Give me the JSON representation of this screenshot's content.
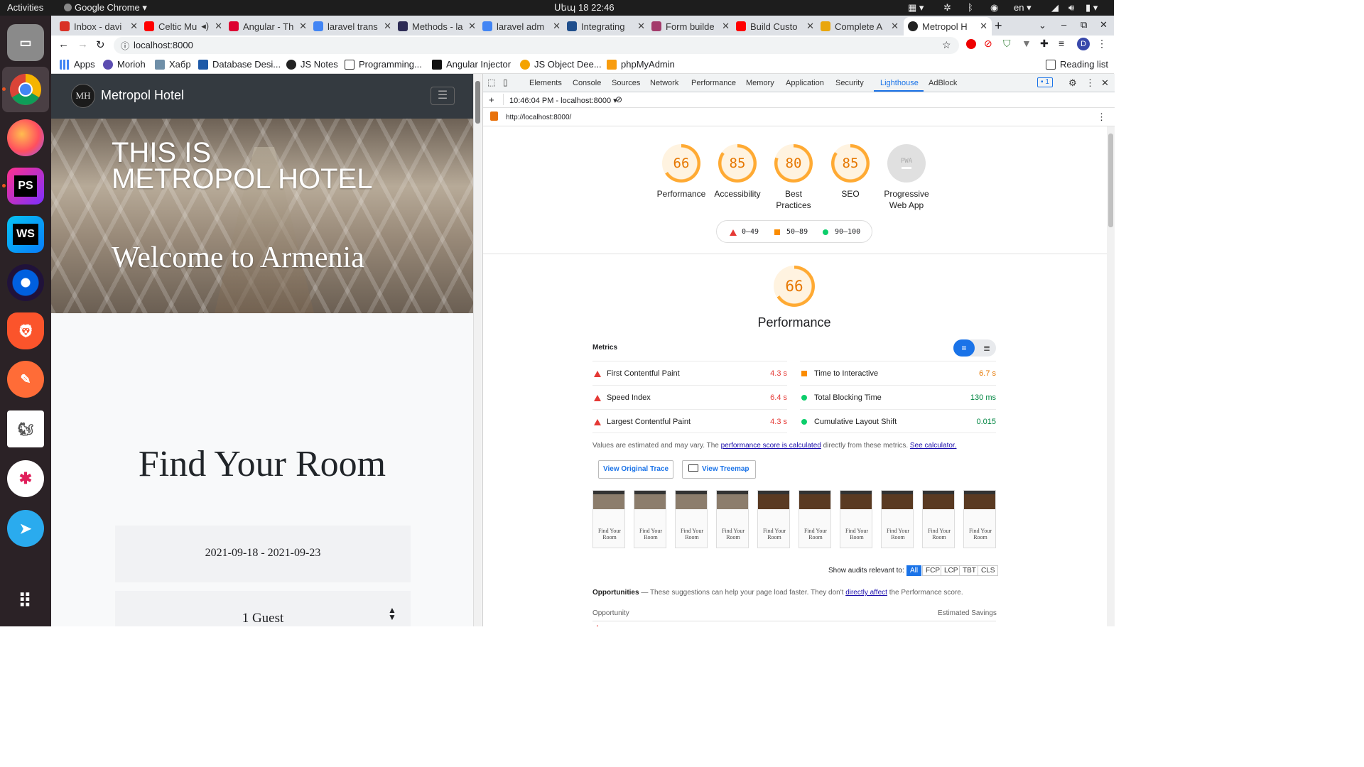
{
  "system_bar": {
    "activities": "Activities",
    "app_name": "Google Chrome",
    "datetime": "Սեպ 18  22:46",
    "language": "en"
  },
  "dock": {
    "items": [
      "files",
      "chrome",
      "firefox",
      "phpstorm",
      "webstorm",
      "firefox-developer",
      "brave",
      "postman",
      "dbeaver",
      "slack",
      "telegram",
      "app-grid"
    ]
  },
  "chrome": {
    "tabs": [
      {
        "label": "Inbox - davi",
        "color": "#d93025"
      },
      {
        "label": "Celtic Mu",
        "color": "#ff0000"
      },
      {
        "label": "Angular - Th",
        "color": "#dd0031"
      },
      {
        "label": "laravel trans",
        "color": "#4285f4"
      },
      {
        "label": "Methods - la",
        "color": "#2d2b55"
      },
      {
        "label": "laravel adm",
        "color": "#4285f4"
      },
      {
        "label": "Integrating",
        "color": "#1f4e8c"
      },
      {
        "label": "Form builde",
        "color": "#a33b6b"
      },
      {
        "label": "Build Custo",
        "color": "#ff0000"
      },
      {
        "label": "Complete A",
        "color": "#e9a60c"
      },
      {
        "label": "Metropol H",
        "color": "#222222"
      }
    ],
    "url": "localhost:8000",
    "profile_initial": "D",
    "bookmarks": [
      "Apps",
      "Morioh",
      "Хабр",
      "Database Desi...",
      "JS Notes",
      "Programming...",
      "Angular Injector",
      "JS Object Dee...",
      "phpMyAdmin"
    ],
    "reading_list": "Reading list"
  },
  "page": {
    "brand": "Metropol Hotel",
    "logo_text": "MH",
    "hero_line1": "THIS IS",
    "hero_line2": "METROPOL HOTEL",
    "hero_sub": "Welcome to Armenia",
    "find_title": "Find Your Room",
    "date_range": "2021-09-18 - 2021-09-23",
    "guests": "1 Guest"
  },
  "devtools": {
    "tabs": [
      "Elements",
      "Console",
      "Sources",
      "Network",
      "Performance",
      "Memory",
      "Application",
      "Security",
      "Lighthouse",
      "AdBlock"
    ],
    "active_tab": "Lighthouse",
    "issues_count": "1",
    "report_time": "10:46:04 PM - localhost:8000",
    "report_url": "http://localhost:8000/",
    "scores": [
      {
        "label": "Performance",
        "value": "66"
      },
      {
        "label": "Accessibility",
        "value": "85"
      },
      {
        "label": "Best Practices",
        "value": "80"
      },
      {
        "label": "SEO",
        "value": "85"
      },
      {
        "label": "Progressive Web App",
        "value": "PWA"
      }
    ],
    "legend": [
      "0–49",
      "50–89",
      "90–100"
    ],
    "perf_score": "66",
    "perf_title": "Performance",
    "metrics_title": "Metrics",
    "metrics": [
      {
        "label": "First Contentful Paint",
        "value": "4.3 s",
        "status": "fail",
        "color": "#e53935"
      },
      {
        "label": "Time to Interactive",
        "value": "6.7 s",
        "status": "average",
        "color": "#e67700"
      },
      {
        "label": "Speed Index",
        "value": "6.4 s",
        "status": "fail",
        "color": "#e53935"
      },
      {
        "label": "Total Blocking Time",
        "value": "130 ms",
        "status": "pass",
        "color": "#018642"
      },
      {
        "label": "Largest Contentful Paint",
        "value": "4.3 s",
        "status": "fail",
        "color": "#e53935"
      },
      {
        "label": "Cumulative Layout Shift",
        "value": "0.015",
        "status": "pass",
        "color": "#018642"
      }
    ],
    "estimate_note_a": "Values are estimated and may vary. The ",
    "estimate_link1": "performance score is calculated",
    "estimate_note_b": " directly from these metrics. ",
    "estimate_link2": "See calculator.",
    "btn_trace": "View Original Trace",
    "btn_treemap": "View Treemap",
    "thumb_text": "Find Your Room",
    "audits_label": "Show audits relevant to:",
    "audit_filters": [
      "All",
      "FCP",
      "LCP",
      "TBT",
      "CLS"
    ],
    "opp_title": "Opportunities",
    "opp_desc_a": " — These suggestions can help your page load faster. They don't ",
    "opp_link": "directly affect",
    "opp_desc_b": " the Performance score.",
    "opp_col1": "Opportunity",
    "opp_col2": "Estimated Savings"
  }
}
